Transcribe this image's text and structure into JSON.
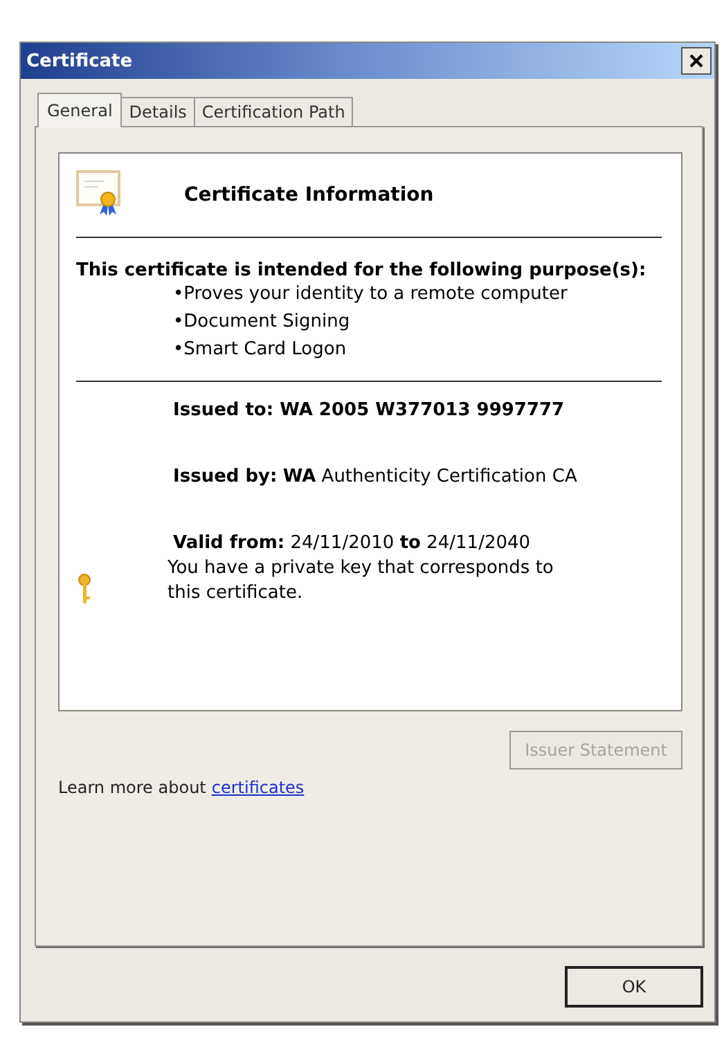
{
  "window": {
    "title": "Certificate"
  },
  "tabs": [
    {
      "label": "General",
      "selected": true
    },
    {
      "label": "Details",
      "selected": false
    },
    {
      "label": "Certification Path",
      "selected": false
    }
  ],
  "panel": {
    "heading": "Certificate Information",
    "purpose_intro": "This certificate is intended for the following purpose(s):",
    "purposes": [
      "•Proves your identity to a remote computer",
      "•Document Signing",
      "•Smart Card Logon"
    ],
    "issued_to": {
      "label": "Issued to:",
      "value": "WA 2005 W377013 9997777"
    },
    "issued_by": {
      "label": "Issued by:",
      "value": "**WA** Authenticity Certification CA"
    },
    "validity": "**Valid from:** 24/11/2010 **to** 24/11/2040",
    "key_note": "You have a private key that corresponds to this certificate."
  },
  "issuer_statement": {
    "label": "Issuer Statement",
    "disabled": true
  },
  "learn_more": {
    "text": "Learn more about",
    "link": "certificates"
  },
  "buttons": [
    "OK"
  ]
}
